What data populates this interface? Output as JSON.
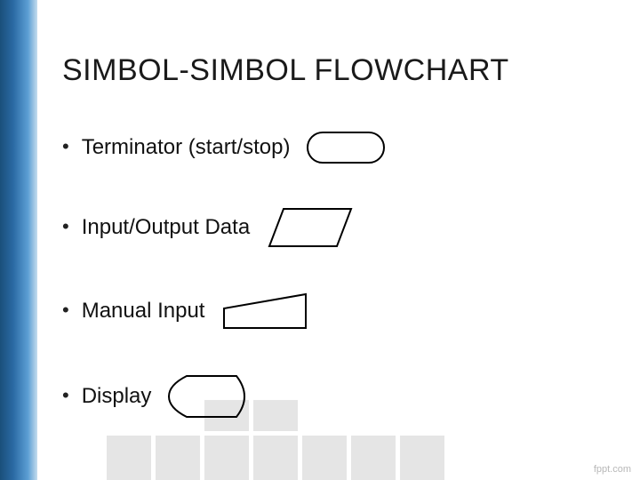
{
  "title": "SIMBOL-SIMBOL FLOWCHART",
  "items": [
    {
      "label": "Terminator (start/stop)",
      "shape": "terminator"
    },
    {
      "label": "Input/Output Data",
      "shape": "parallelogram"
    },
    {
      "label": "Manual Input",
      "shape": "manual-input"
    },
    {
      "label": "Display",
      "shape": "display"
    }
  ],
  "footer": "fppt.com"
}
